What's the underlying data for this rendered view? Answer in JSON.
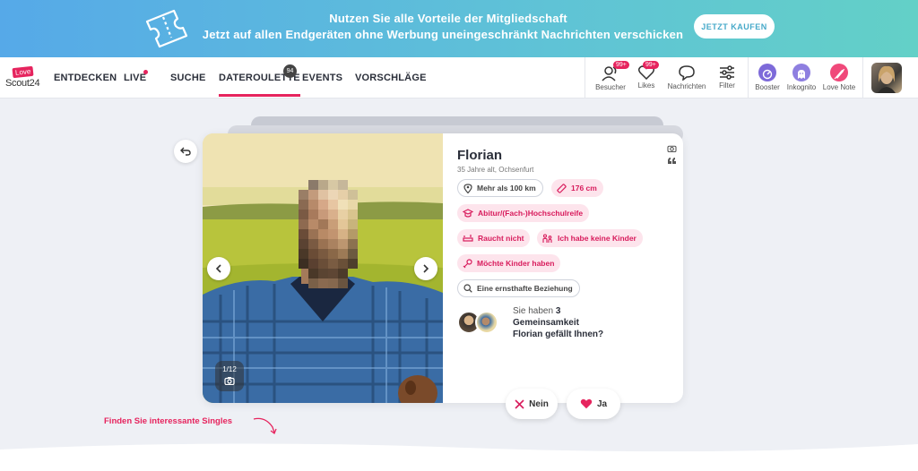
{
  "promo": {
    "line1": "Nutzen Sie alle Vorteile der Mitgliedschaft",
    "line2": "Jetzt auf allen Endgeräten ohne Werbung uneingeschränkt Nachrichten verschicken",
    "buy_label": "JETZT KAUFEN"
  },
  "logo": {
    "top": "Love",
    "bottom": "Scout24"
  },
  "nav": {
    "items": [
      {
        "label": "ENTDECKEN"
      },
      {
        "label": "LIVE"
      },
      {
        "label": "SUCHE"
      },
      {
        "label": "DATEROULETTE"
      },
      {
        "label": "EVENTS"
      },
      {
        "label": "VORSCHLÄGE"
      }
    ],
    "dateroulette_badge": "94",
    "right": {
      "besucher": {
        "label": "Besucher",
        "badge": "99+"
      },
      "likes": {
        "label": "Likes",
        "badge": "99+"
      },
      "nachrichten": {
        "label": "Nachrichten"
      },
      "filter": {
        "label": "Filter"
      },
      "booster": {
        "label": "Booster"
      },
      "inkognito": {
        "label": "Inkognito"
      },
      "lovenote": {
        "label": "Love Note"
      }
    }
  },
  "profile": {
    "name": "Florian",
    "meta": "35 Jahre alt, Ochsenfurt",
    "photo_counter": "1/12",
    "tags": {
      "distance": "Mehr als 100 km",
      "height": "176 cm",
      "education": "Abitur/(Fach-)Hochschulreife",
      "smoking": "Raucht nicht",
      "kids": "Ich habe keine Kinder",
      "wants_kids": "Möchte Kinder haben",
      "relationship": "Eine ernsthafte Beziehung"
    },
    "common": {
      "prefix": "Sie haben",
      "count": "3",
      "word": "Gemeinsamkeit",
      "question": "Florian gefällt Ihnen?"
    }
  },
  "actions": {
    "no_label": "Nein",
    "yes_label": "Ja"
  },
  "hint": "Finden Sie interessante Singles",
  "colors": {
    "accent": "#e6245e",
    "booster": "#7d6ad9",
    "inkognito": "#8e7fe0",
    "lovenote": "#f0497a"
  }
}
